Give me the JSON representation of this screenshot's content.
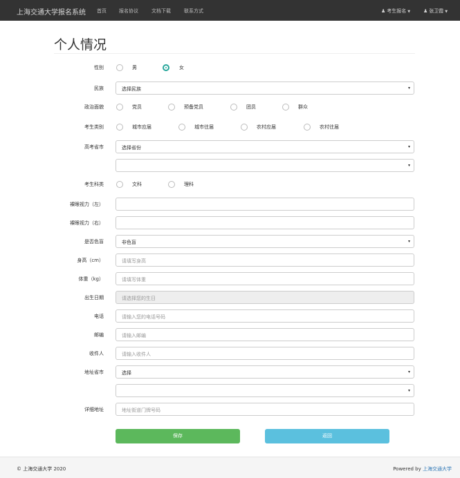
{
  "navbar": {
    "brand": "上海交通大学报名系统",
    "links": [
      "首页",
      "报名协议",
      "文档下载",
      "联系方式"
    ],
    "right_menu_1": "考生报名",
    "right_menu_2": "张卫霞",
    "user_icon": "user-icon"
  },
  "page": {
    "title": "个人情况"
  },
  "form": {
    "gender": {
      "label": "性别",
      "options": [
        "男",
        "女"
      ],
      "selected": "女"
    },
    "ethnicity": {
      "label": "民族",
      "value": "选择民族"
    },
    "political": {
      "label": "政治面貌",
      "options": [
        "党员",
        "预备党员",
        "团员",
        "群众"
      ]
    },
    "category": {
      "label": "考生类别",
      "options": [
        "城市应届",
        "城市往届",
        "农村应届",
        "农村往届"
      ]
    },
    "exam_province": {
      "label": "高考省市",
      "value": "选择省份",
      "value2": ""
    },
    "subject": {
      "label": "考生科类",
      "options": [
        "文科",
        "理科"
      ]
    },
    "vision_left": {
      "label": "裸眼视力（左）",
      "value": ""
    },
    "vision_right": {
      "label": "裸眼视力（右）",
      "value": ""
    },
    "color_blind": {
      "label": "是否色盲",
      "value": "非色盲"
    },
    "height": {
      "label": "身高（cm）",
      "placeholder": "请填写身高"
    },
    "weight": {
      "label": "体重（kg）",
      "placeholder": "请填写体重"
    },
    "birthdate": {
      "label": "出生日期",
      "placeholder": "请选择您的生日"
    },
    "phone": {
      "label": "电话",
      "placeholder": "请输入您的电话号码"
    },
    "zipcode": {
      "label": "邮编",
      "placeholder": "请输入邮编"
    },
    "recipient": {
      "label": "收件人",
      "placeholder": "请输入收件人"
    },
    "address_province": {
      "label": "地址省市",
      "value": "选择",
      "value2": ""
    },
    "address_detail": {
      "label": "详细地址",
      "placeholder": "地址街道门牌号码"
    }
  },
  "buttons": {
    "save": "保存",
    "back": "返回"
  },
  "footer": {
    "copyright": "© 上海交通大学 2020",
    "powered_prefix": "Powered by",
    "powered_link": "上海交通大学"
  },
  "colors": {
    "navbar": "#333333",
    "accent": "#26a69a",
    "save": "#5cb85c",
    "back": "#5bc0de",
    "link": "#337ab7"
  }
}
